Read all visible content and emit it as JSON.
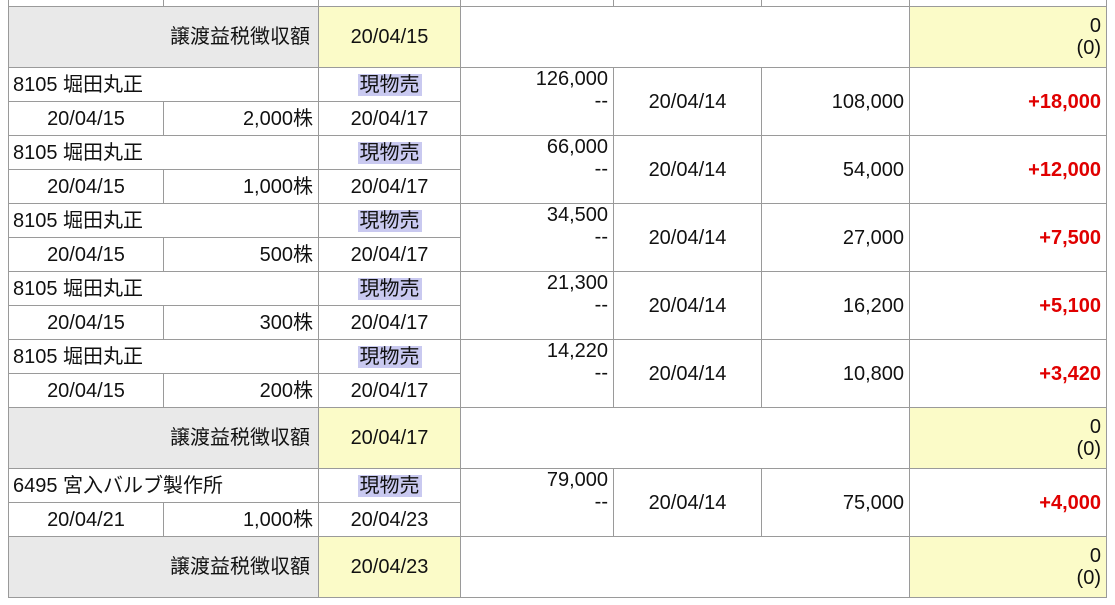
{
  "tax_rows": [
    {
      "label": "譲渡益税徴収額",
      "date": "20/04/15",
      "amount": "0",
      "amount_sub": "(0)"
    },
    {
      "label": "譲渡益税徴収額",
      "date": "20/04/17",
      "amount": "0",
      "amount_sub": "(0)"
    },
    {
      "label": "譲渡益税徴収額",
      "date": "20/04/23",
      "amount": "0",
      "amount_sub": "(0)"
    }
  ],
  "trades": [
    {
      "name": "8105 堀田丸正",
      "type": "現物売",
      "sell_price": "126,000",
      "sell_price_sub": "--",
      "buy_date": "20/04/14",
      "buy_price": "108,000",
      "pl": "+18,000",
      "trade_date": "20/04/15",
      "qty": "2,000株",
      "settle_date": "20/04/17"
    },
    {
      "name": "8105 堀田丸正",
      "type": "現物売",
      "sell_price": "66,000",
      "sell_price_sub": "--",
      "buy_date": "20/04/14",
      "buy_price": "54,000",
      "pl": "+12,000",
      "trade_date": "20/04/15",
      "qty": "1,000株",
      "settle_date": "20/04/17"
    },
    {
      "name": "8105 堀田丸正",
      "type": "現物売",
      "sell_price": "34,500",
      "sell_price_sub": "--",
      "buy_date": "20/04/14",
      "buy_price": "27,000",
      "pl": "+7,500",
      "trade_date": "20/04/15",
      "qty": "500株",
      "settle_date": "20/04/17"
    },
    {
      "name": "8105 堀田丸正",
      "type": "現物売",
      "sell_price": "21,300",
      "sell_price_sub": "--",
      "buy_date": "20/04/14",
      "buy_price": "16,200",
      "pl": "+5,100",
      "trade_date": "20/04/15",
      "qty": "300株",
      "settle_date": "20/04/17"
    },
    {
      "name": "8105 堀田丸正",
      "type": "現物売",
      "sell_price": "14,220",
      "sell_price_sub": "--",
      "buy_date": "20/04/14",
      "buy_price": "10,800",
      "pl": "+3,420",
      "trade_date": "20/04/15",
      "qty": "200株",
      "settle_date": "20/04/17"
    },
    {
      "name": "6495 宮入バルブ製作所",
      "type": "現物売",
      "sell_price": "79,000",
      "sell_price_sub": "--",
      "buy_date": "20/04/14",
      "buy_price": "75,000",
      "pl": "+4,000",
      "trade_date": "20/04/21",
      "qty": "1,000株",
      "settle_date": "20/04/23"
    }
  ],
  "colors": {
    "profit": "#e00000",
    "tax_row_bg": "#e9e9e9",
    "date_bg": "#fbfbc8",
    "badge_bg": "#c9c9f0"
  }
}
